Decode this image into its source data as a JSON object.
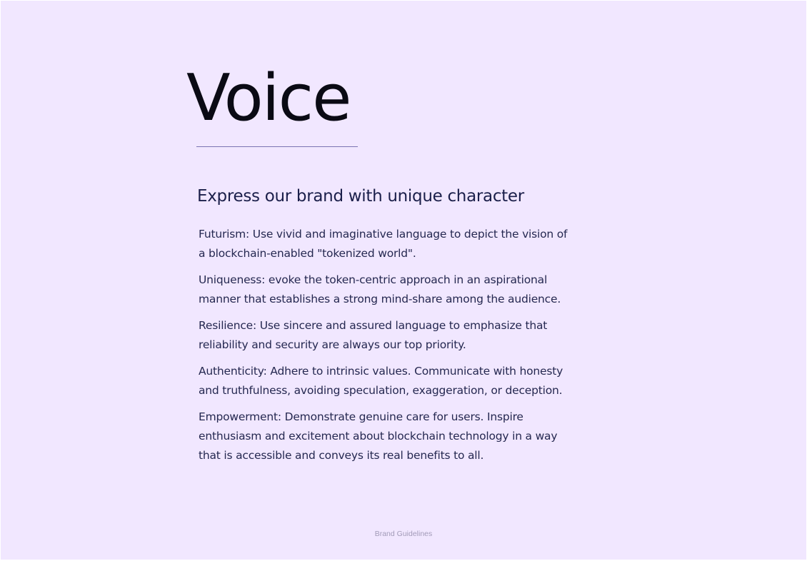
{
  "page": {
    "title": "Voice",
    "subtitle": "Express our brand with unique character",
    "paragraphs": [
      "Futurism: Use vivid and imaginative language to depict the vision of a blockchain-enabled \"tokenized world\".",
      "Uniqueness: evoke the token-centric approach in an aspirational manner that establishes a strong mind-share among the audience.",
      "Resilience: Use sincere and assured language to emphasize that reliability and security are always our top priority.",
      "Authenticity: Adhere to intrinsic values. Communicate with honesty and truthfulness, avoiding speculation, exaggeration, or deception.",
      "Empowerment: Demonstrate genuine care for users. Inspire enthusiasm and excitement about blockchain technology in a way that is accessible and conveys its real benefits to all."
    ],
    "footer": "Brand Guidelines"
  },
  "colors": {
    "background": "#f1e7ff",
    "title": "#0a0a14",
    "subtitle": "#1b1f4a",
    "body_text": "#252850",
    "rule": "#7b74b2",
    "footer": "#a29bb8"
  }
}
